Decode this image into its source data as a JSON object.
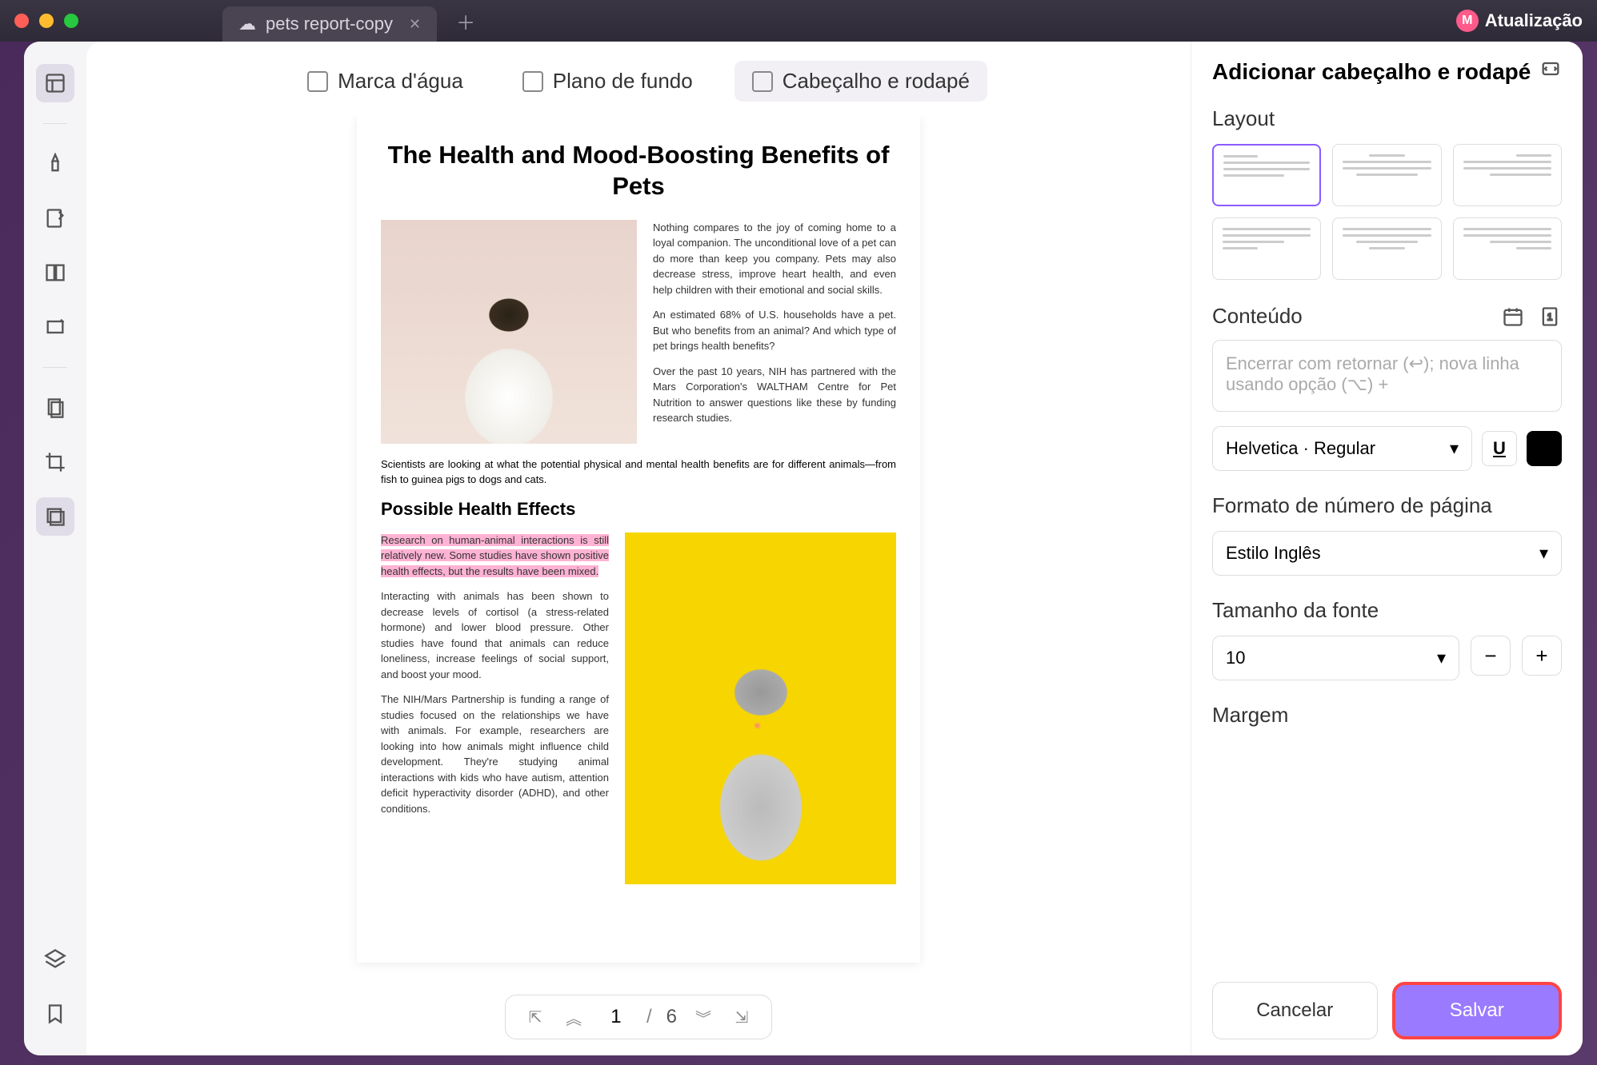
{
  "titlebar": {
    "tab_name": "pets report-copy",
    "update_label": "Atualização",
    "update_badge": "M"
  },
  "top_tabs": {
    "watermark": "Marca d'água",
    "background": "Plano de fundo",
    "header_footer": "Cabeçalho e rodapé"
  },
  "document": {
    "title": "The Health and Mood-Boosting Benefits of Pets",
    "p1": "Nothing compares to the joy of coming home to a loyal companion. The unconditional love of a pet can do more than keep you company. Pets may also decrease stress, improve heart health, and even help children with their emotional and social skills.",
    "p2": "An estimated 68% of U.S. households have a pet. But who benefits from an animal? And which type of pet brings health benefits?",
    "p3": "Over the past 10 years, NIH has partnered with the Mars Corporation's WALTHAM Centre for Pet Nutrition to answer questions like these by funding research studies.",
    "p4": "Scientists are looking at what the potential physical and mental health benefits are for different animals—from fish to guinea pigs to dogs and cats.",
    "subheading": "Possible Health Effects",
    "p5": "Research on human-animal interactions is still relatively new. Some studies have shown positive health effects, but the results have been mixed.",
    "p6": "Interacting with animals has been shown to decrease levels of cortisol (a stress-related hormone) and lower blood pressure. Other studies have found that animals can reduce loneliness, increase feelings of social support, and boost your mood.",
    "p7": "The NIH/Mars Partnership is funding a range of studies focused on the relationships we have with animals. For example, researchers are looking into how animals might influence child development. They're studying animal interactions with kids who have autism, attention deficit hyperactivity disorder (ADHD), and other conditions."
  },
  "pager": {
    "current": "1",
    "separator": "/",
    "total": "6"
  },
  "panel": {
    "title": "Adicionar cabeçalho e rodapé",
    "layout_label": "Layout",
    "content_label": "Conteúdo",
    "content_placeholder": "Encerrar com retornar (↩︎); nova linha usando opção (⌥) +",
    "font_value": "Helvetica · Regular",
    "underline": "U",
    "page_format_label": "Formato de número de página",
    "page_format_value": "Estilo Inglês",
    "font_size_label": "Tamanho da fonte",
    "font_size_value": "10",
    "margin_label": "Margem",
    "cancel": "Cancelar",
    "save": "Salvar"
  }
}
